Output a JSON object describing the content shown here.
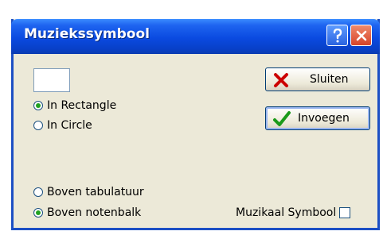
{
  "window": {
    "title": "Muziekssymbool"
  },
  "shape_options": [
    {
      "label": "In Rectangle",
      "checked": true
    },
    {
      "label": "In Circle",
      "checked": false
    }
  ],
  "position_options": [
    {
      "label": "Boven tabulatuur",
      "checked": false
    },
    {
      "label": "Boven notenbalk",
      "checked": true
    }
  ],
  "buttons": {
    "close_label": "Sluiten",
    "insert_label": "Invoegen"
  },
  "checkbox": {
    "label": "Muzikaal Symbool",
    "checked": false
  },
  "colors": {
    "title_bar": "#0a4ae0",
    "dialog_bg": "#ece9d8",
    "radio_dot": "#21a121",
    "close_x": "#cc0000",
    "insert_check": "#1a9a1a"
  },
  "icons": {
    "help": "question-mark-icon",
    "close": "close-icon",
    "close_button": "red-x-icon",
    "insert_button": "green-check-icon"
  }
}
